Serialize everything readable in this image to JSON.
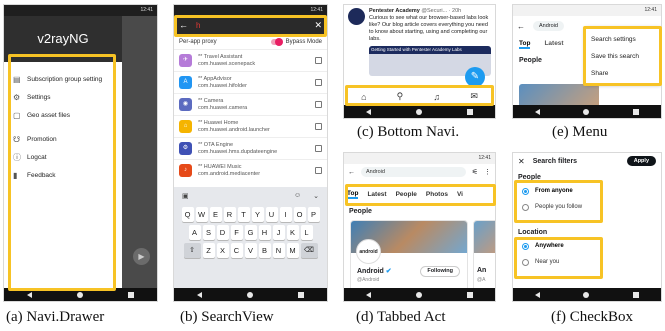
{
  "captions": {
    "a": "(a) Navi.Drawer",
    "b": "(b) SearchView",
    "c": "(c) Bottom Navi.",
    "d": "(d) Tabbed Act",
    "e": "(e) Menu",
    "f": "(f) CheckBox"
  },
  "colors": {
    "highlight": "#f7c325",
    "twitter_blue": "#1d9bf0",
    "toggle_pink": "#e91e63",
    "dark_header": "#2f2f2f"
  },
  "status_time": "12:41",
  "navbar_icons": [
    "back-triangle",
    "home-circle",
    "recents-square"
  ],
  "phone_a": {
    "drawer_title": "v2rayNG",
    "items_group1": [
      {
        "icon": "server-icon",
        "glyph": "▤",
        "label": "Subscription group setting"
      },
      {
        "icon": "gear-icon",
        "glyph": "⚙",
        "label": "Settings"
      },
      {
        "icon": "file-icon",
        "glyph": "▢",
        "label": "Geo asset files"
      }
    ],
    "items_group2": [
      {
        "icon": "promotion-icon",
        "glyph": "☋",
        "label": "Promotion"
      },
      {
        "icon": "info-icon",
        "glyph": "ⓘ",
        "label": "Logcat"
      },
      {
        "icon": "feedback-icon",
        "glyph": "▮",
        "label": "Feedback"
      }
    ]
  },
  "phone_b": {
    "search_query": "h",
    "per_app_label": "Per-app proxy",
    "bypass_label": "Bypass Mode",
    "apps": [
      {
        "name": "** Travel Assistant",
        "package": "com.huawei.scenepack",
        "color": "#b57bd8",
        "glyph": "✈"
      },
      {
        "name": "** AppAdvisor",
        "package": "com.huawei.hifolder",
        "color": "#2196f3",
        "glyph": "A"
      },
      {
        "name": "** Camera",
        "package": "com.huawei.camera",
        "color": "#5c6bc0",
        "glyph": "◉"
      },
      {
        "name": "** Huawei Home",
        "package": "com.huawei.android.launcher",
        "color": "#f5b400",
        "glyph": "⌂"
      },
      {
        "name": "** OTA Engine",
        "package": "com.huawei.hms.dupdateengine",
        "color": "#3f51b5",
        "glyph": "⚙"
      },
      {
        "name": "** HUAWEI Music",
        "package": "com.android.mediacenter",
        "color": "#e64a19",
        "glyph": "♪"
      }
    ],
    "keyboard": {
      "row1": [
        "Q",
        "W",
        "E",
        "R",
        "T",
        "Y",
        "U",
        "I",
        "O",
        "P"
      ],
      "row2": [
        "A",
        "S",
        "D",
        "F",
        "G",
        "H",
        "J",
        "K",
        "L"
      ],
      "row3": [
        "Z",
        "X",
        "C",
        "V",
        "B",
        "N",
        "M"
      ]
    }
  },
  "phone_c": {
    "author": "Pentester Academy",
    "handle": "@Securi... · 20h",
    "tweet_text": "Curious to see what our browser-based labs look like? Our blog article covers everything you need to know about starting, using and completing our labs.",
    "card_title": "Getting Started with Pentester Academy Labs",
    "bottom_nav": [
      {
        "icon": "home-icon",
        "glyph": "⌂"
      },
      {
        "icon": "search-icon",
        "glyph": "⚲"
      },
      {
        "icon": "bell-icon",
        "glyph": "♫"
      },
      {
        "icon": "mail-icon",
        "glyph": "✉"
      }
    ]
  },
  "phone_d": {
    "search_value": "Android",
    "tabs": [
      "Top",
      "Latest",
      "People",
      "Photos",
      "Vi"
    ],
    "section_title": "People",
    "profile_name": "Android",
    "profile_handle": "@Android",
    "follow_label": "Following",
    "logo_text": "android",
    "card2_name": "An",
    "card2_handle": "@A"
  },
  "phone_e": {
    "search_value": "Android",
    "tabs": [
      "Top",
      "Latest"
    ],
    "section_title": "People",
    "menu_items": [
      "Search settings",
      "Save this search",
      "Share"
    ]
  },
  "phone_f": {
    "title": "Search filters",
    "apply_label": "Apply",
    "people_section": "People",
    "people_options": [
      {
        "label": "From anyone",
        "selected": true
      },
      {
        "label": "People you follow",
        "selected": false
      }
    ],
    "location_section": "Location",
    "location_options": [
      {
        "label": "Anywhere",
        "selected": true
      },
      {
        "label": "Near you",
        "selected": false
      }
    ]
  }
}
